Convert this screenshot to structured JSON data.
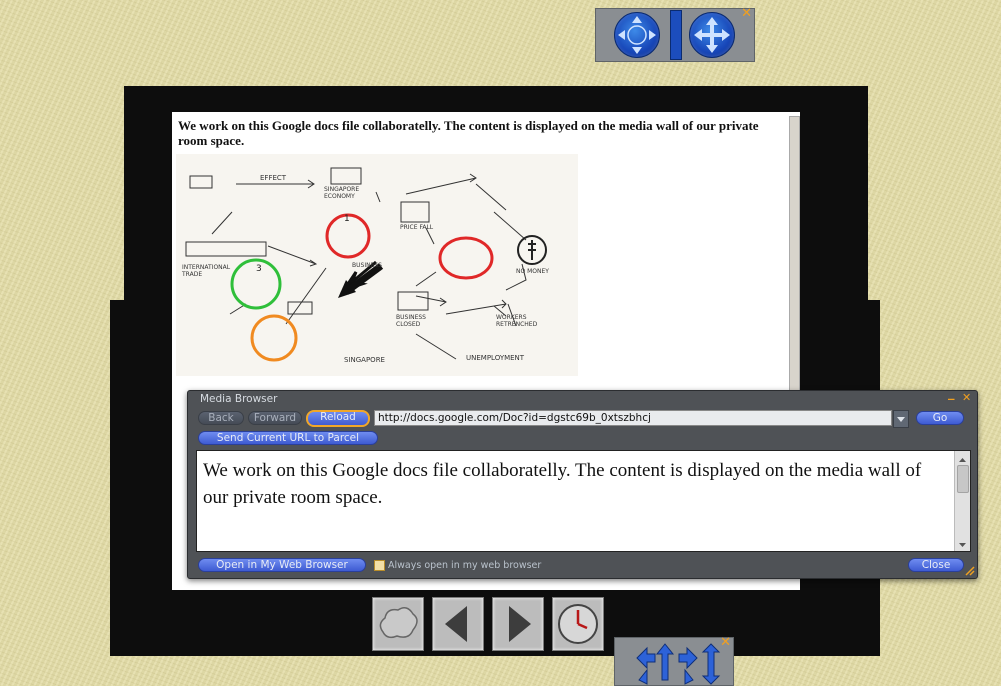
{
  "camera_hud": {
    "close_glyph": "✕"
  },
  "movement_hud": {
    "close_glyph": "✕"
  },
  "document": {
    "text": "We work on this Google docs file collaboratelly. The content is displayed on the media wall of our private room space.",
    "sketch_labels": [
      "EFFECT",
      "SINGAPORE",
      "UNEMPLOYMENT",
      "INTERNATIONAL TRADE",
      "BUSINESS",
      "SINGAPORE ECONOMY",
      "PRICE FALL",
      "NO MONEY",
      "BUSINESS CLOSED",
      "WORKERS RETRENCHED",
      "1",
      "3"
    ]
  },
  "media_browser": {
    "title": "Media Browser",
    "minimize": "_",
    "close_glyph": "✕",
    "back_label": "Back",
    "forward_label": "Forward",
    "reload_label": "Reload",
    "url": "http://docs.google.com/Doc?id=dgstc69b_0xtszbhcj",
    "go_label": "Go",
    "send_url_label": "Send Current URL to Parcel",
    "content_text": "We work on this Google docs file collaboratelly. The content is displayed on the media wall of our private room space.",
    "open_external_label": "Open in My Web Browser",
    "always_open_label": "Always open in my web browser",
    "close_label": "Close"
  },
  "media_controls": {
    "prev_label": "Prev",
    "next_label": "Next"
  },
  "colors": {
    "background": "#e3dca6",
    "accent_blue": "#3e5bd2",
    "highlight_orange": "#f0a72a",
    "circle_red": "#e02828",
    "circle_green": "#2fbf3a",
    "circle_orange": "#f08a20"
  }
}
